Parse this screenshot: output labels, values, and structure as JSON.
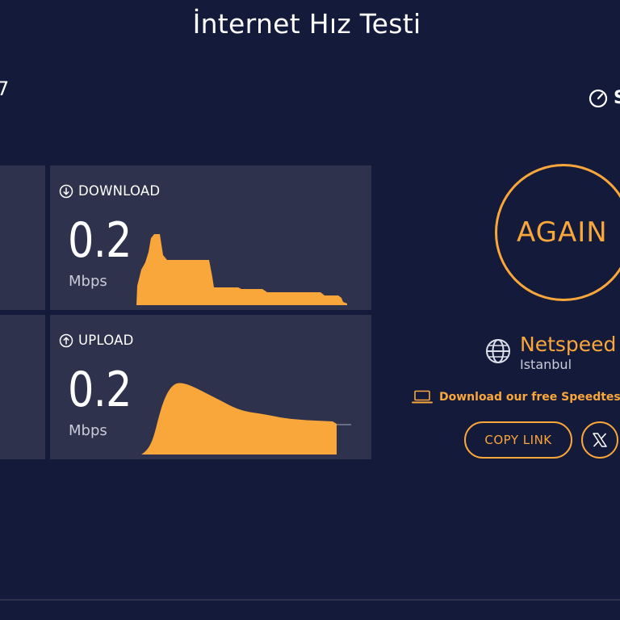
{
  "page": {
    "title": "İnternet Hız Testi"
  },
  "edge": {
    "left_glyph": "7",
    "right_text": "S"
  },
  "results": {
    "download": {
      "label": "DOWNLOAD",
      "value": "0.2",
      "unit": "Mbps",
      "icon": "arrow-down-circle-icon"
    },
    "upload": {
      "label": "UPLOAD",
      "value": "0.2",
      "unit": "Mbps",
      "icon": "arrow-up-circle-icon"
    }
  },
  "actions": {
    "again_label": "AGAIN",
    "app_link_text": "Download our free Speedtest",
    "copy_link_label": "COPY LINK"
  },
  "server": {
    "name": "Netspeed",
    "location": "Istanbul"
  },
  "colors": {
    "accent": "#f9a63a",
    "background": "#141a3a",
    "card": "#2e324c"
  }
}
